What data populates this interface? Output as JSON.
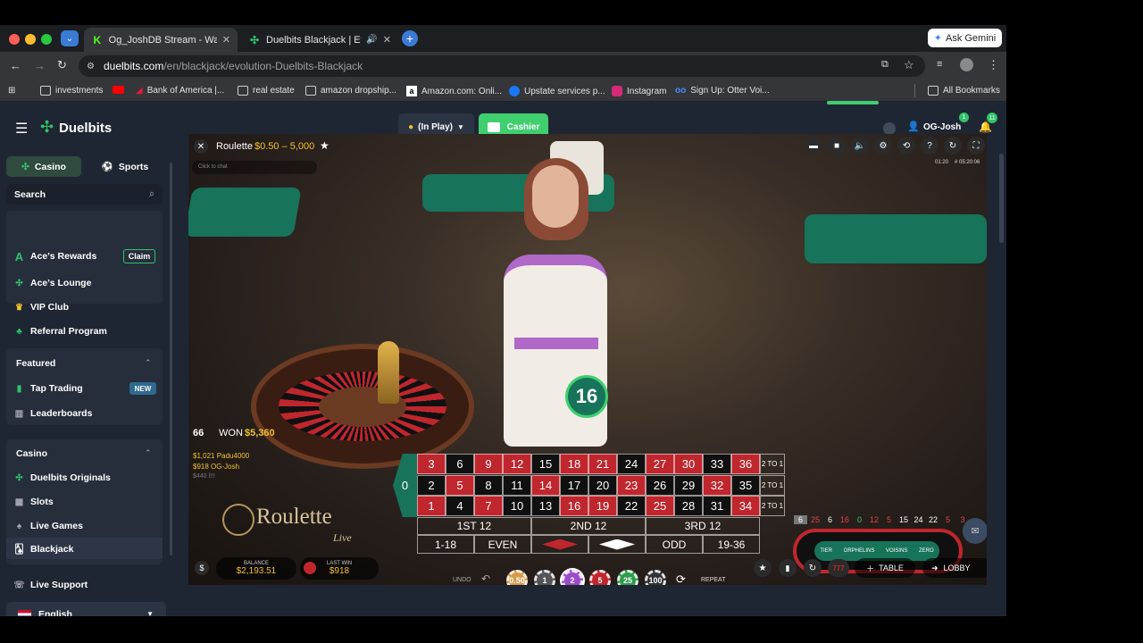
{
  "browser": {
    "tabs": [
      {
        "title": "Og_JoshDB Stream - Watch Li",
        "favicon": "K",
        "favicon_color": "#53fc18"
      },
      {
        "title": "Duelbits Blackjack | Evolutio",
        "favicon": "duelbits-icon",
        "favicon_color": "#30c36a"
      }
    ],
    "ask_gemini": "Ask Gemini",
    "url": "duelbits.com",
    "url_path": "/en/blackjack/evolution-Duelbits-Blackjack",
    "bookmarks": [
      "investments",
      "Bank of America |...",
      "real estate",
      "amazon dropship...",
      "Amazon.com: Onli...",
      "Upstate services p...",
      "Instagram",
      "Sign Up: Otter Voi..."
    ],
    "all_bookmarks": "All Bookmarks"
  },
  "header": {
    "brand": "Duelbits",
    "balance_label": "(In Play)",
    "cashier": "Cashier",
    "username": "OG-Josh",
    "user_badge": "1",
    "notif_badge": "11"
  },
  "sidebar": {
    "casino_tab": "Casino",
    "sports_tab": "Sports",
    "search_placeholder": "Search",
    "rewards": "Ace's Rewards",
    "claim": "Claim",
    "lounge": "Ace's Lounge",
    "vip": "VIP Club",
    "referral": "Referral Program",
    "featured": "Featured",
    "tap_trading": "Tap Trading",
    "new_badge": "NEW",
    "leaderboards": "Leaderboards",
    "casino_section": "Casino",
    "originals": "Duelbits Originals",
    "slots": "Slots",
    "live_games": "Live Games",
    "blackjack": "Blackjack",
    "support": "Live Support",
    "language": "English"
  },
  "game": {
    "title": "Roulette",
    "limits": "$0.50 – 5,000",
    "chat_placeholder": "Click to chat",
    "timer": "01:20",
    "round": "# 05:20:06",
    "result_number": "16",
    "won_number": "66",
    "won_label": "WON",
    "won_amount": "$5,360",
    "winners": [
      "$1,021 Padu4000",
      "$918 OG-Josh",
      "$440 l!!!"
    ],
    "logo_main": "Roulette",
    "logo_sub": "Live",
    "balance_label": "BALANCE",
    "balance_value": "$2,193.51",
    "lastwin_label": "LAST WIN",
    "lastwin_value": "$918",
    "undo": "UNDO",
    "repeat": "REPEAT",
    "chips": [
      "0.50",
      "1",
      "2",
      "5",
      "25",
      "100"
    ],
    "table_btn": "TABLE",
    "lobby_btn": "LOBBY",
    "history": [
      "6",
      "25",
      "6",
      "16",
      "0",
      "12",
      "5",
      "15",
      "24",
      "22",
      "5",
      "3"
    ],
    "racetrack": [
      "TIER",
      "ORPHELINS",
      "VOISINS",
      "ZERO"
    ],
    "zero": "0",
    "rows": [
      [
        "3",
        "6",
        "9",
        "12",
        "15",
        "18",
        "21",
        "24",
        "27",
        "30",
        "33",
        "36"
      ],
      [
        "2",
        "5",
        "8",
        "11",
        "14",
        "17",
        "20",
        "23",
        "26",
        "29",
        "32",
        "35"
      ],
      [
        "1",
        "4",
        "7",
        "10",
        "13",
        "16",
        "19",
        "22",
        "25",
        "28",
        "31",
        "34"
      ]
    ],
    "column_bet": "2 TO 1",
    "dozens": [
      "1ST 12",
      "2ND 12",
      "3RD 12"
    ],
    "outside": [
      "1-18",
      "EVEN",
      "",
      "",
      "ODD",
      "19-36"
    ],
    "colors": {
      "red": "#c0262d",
      "black": "#101010",
      "green": "#17735a",
      "accent": "#30c36a"
    }
  }
}
